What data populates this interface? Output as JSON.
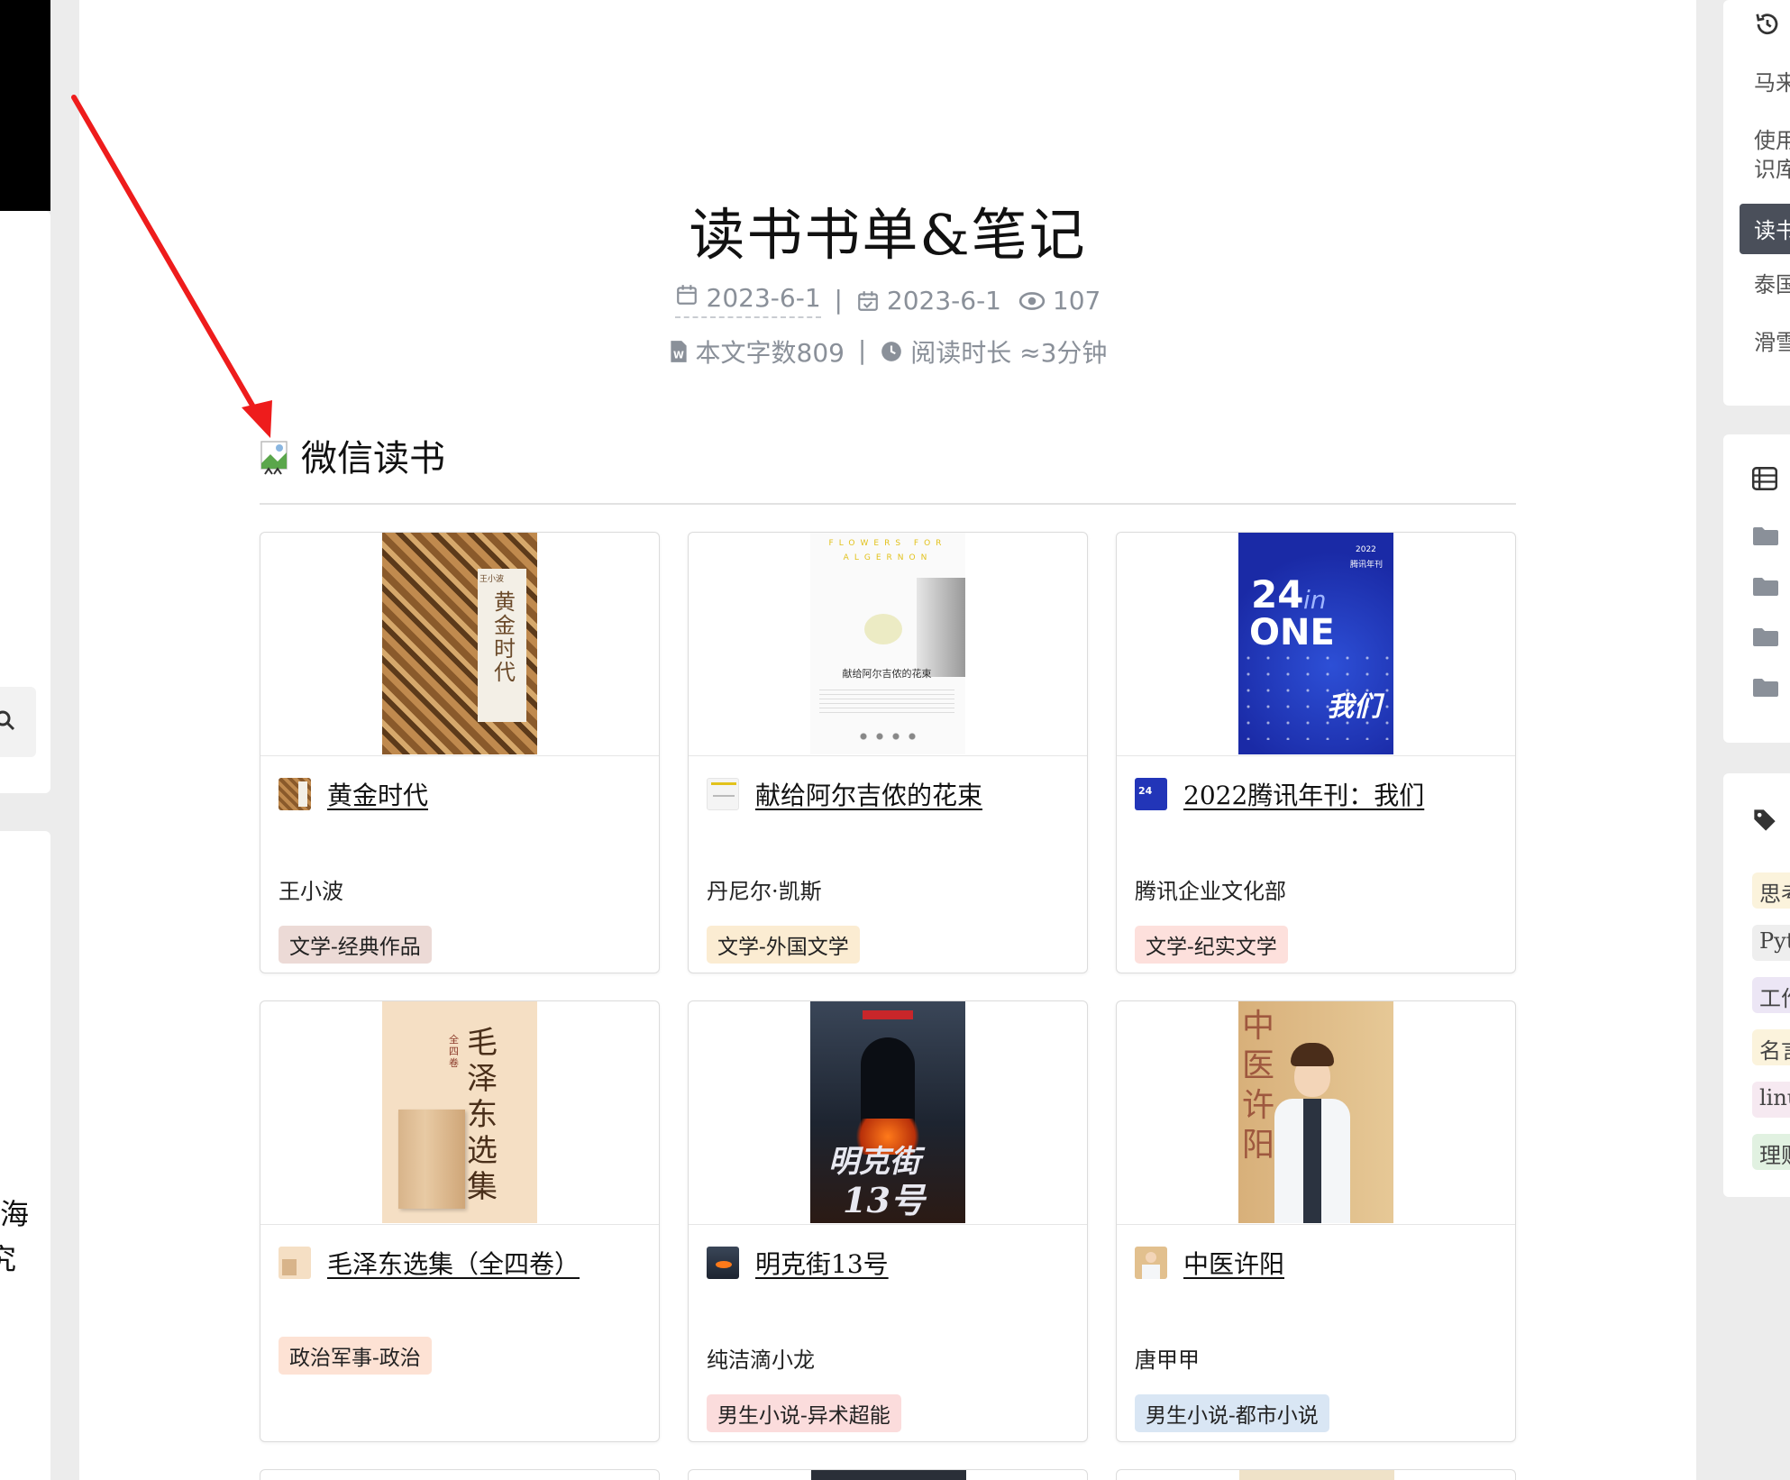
{
  "left": {
    "text_lines": [
      "海",
      "究"
    ]
  },
  "article": {
    "title": "读书书单&笔记",
    "created": "2023-6-1",
    "updated": "2023-6-1",
    "views": "107",
    "word_count": "本文字数809",
    "read_time": "阅读时长 ≈3分钟",
    "meta_separator": "|"
  },
  "section": {
    "title": "微信读书"
  },
  "books": [
    {
      "title": "黄金时代",
      "author": "王小波",
      "tag": "文学-经典作品",
      "tag_color": "#ecdad6"
    },
    {
      "title": "献给阿尔吉侬的花束",
      "author": "丹尼尔·凯斯",
      "tag": "文学-外国文学",
      "tag_color": "#fbecd2"
    },
    {
      "title": "2022腾讯年刊：我们",
      "author": "腾讯企业文化部",
      "tag": "文学-纪实文学",
      "tag_color": "#fde0dc"
    },
    {
      "title": "毛泽东选集（全四卷）",
      "author": "",
      "tag": "政治军事-政治",
      "tag_color": "#fde2d4"
    },
    {
      "title": "明克街13号",
      "author": "纯洁滴小龙",
      "tag": "男生小说-异术超能",
      "tag_color": "#fbdcdc"
    },
    {
      "title": "中医许阳",
      "author": "唐甲甲",
      "tag": "男生小说-都市小说",
      "tag_color": "#d9e6f4"
    }
  ],
  "cover_text": {
    "book1_vertical": "黄金时代",
    "book1_author": "王小波",
    "book2_banner": "FLOWERS FOR ALGERNON",
    "book2_title": "献给阿尔吉侬的花束",
    "book3_big": "24",
    "book3_in": "in",
    "book3_one": "ONE",
    "book3_year": "2022",
    "book3_sub": "腾讯年刊",
    "book3_we": "我们",
    "book4_vertical": "毛泽东选集",
    "book4_label": "全四卷",
    "book5_title": "明克街",
    "book5_num": "13号",
    "book6_vertical": "中医许阳"
  },
  "sidebar": {
    "recent": [
      "马来",
      "使用",
      "识库",
      "泰国",
      "滑雪"
    ],
    "active": "读书",
    "tags": [
      {
        "label": "思考",
        "color": "#fbf3dc"
      },
      {
        "label": "Pyt",
        "color": "#eeeeee"
      },
      {
        "label": "工作",
        "color": "#ece6f5"
      },
      {
        "label": "名言",
        "color": "#fbf3dc"
      },
      {
        "label": "linu",
        "color": "#f6e9f1"
      },
      {
        "label": "理财",
        "color": "#e1f1e1"
      }
    ]
  }
}
